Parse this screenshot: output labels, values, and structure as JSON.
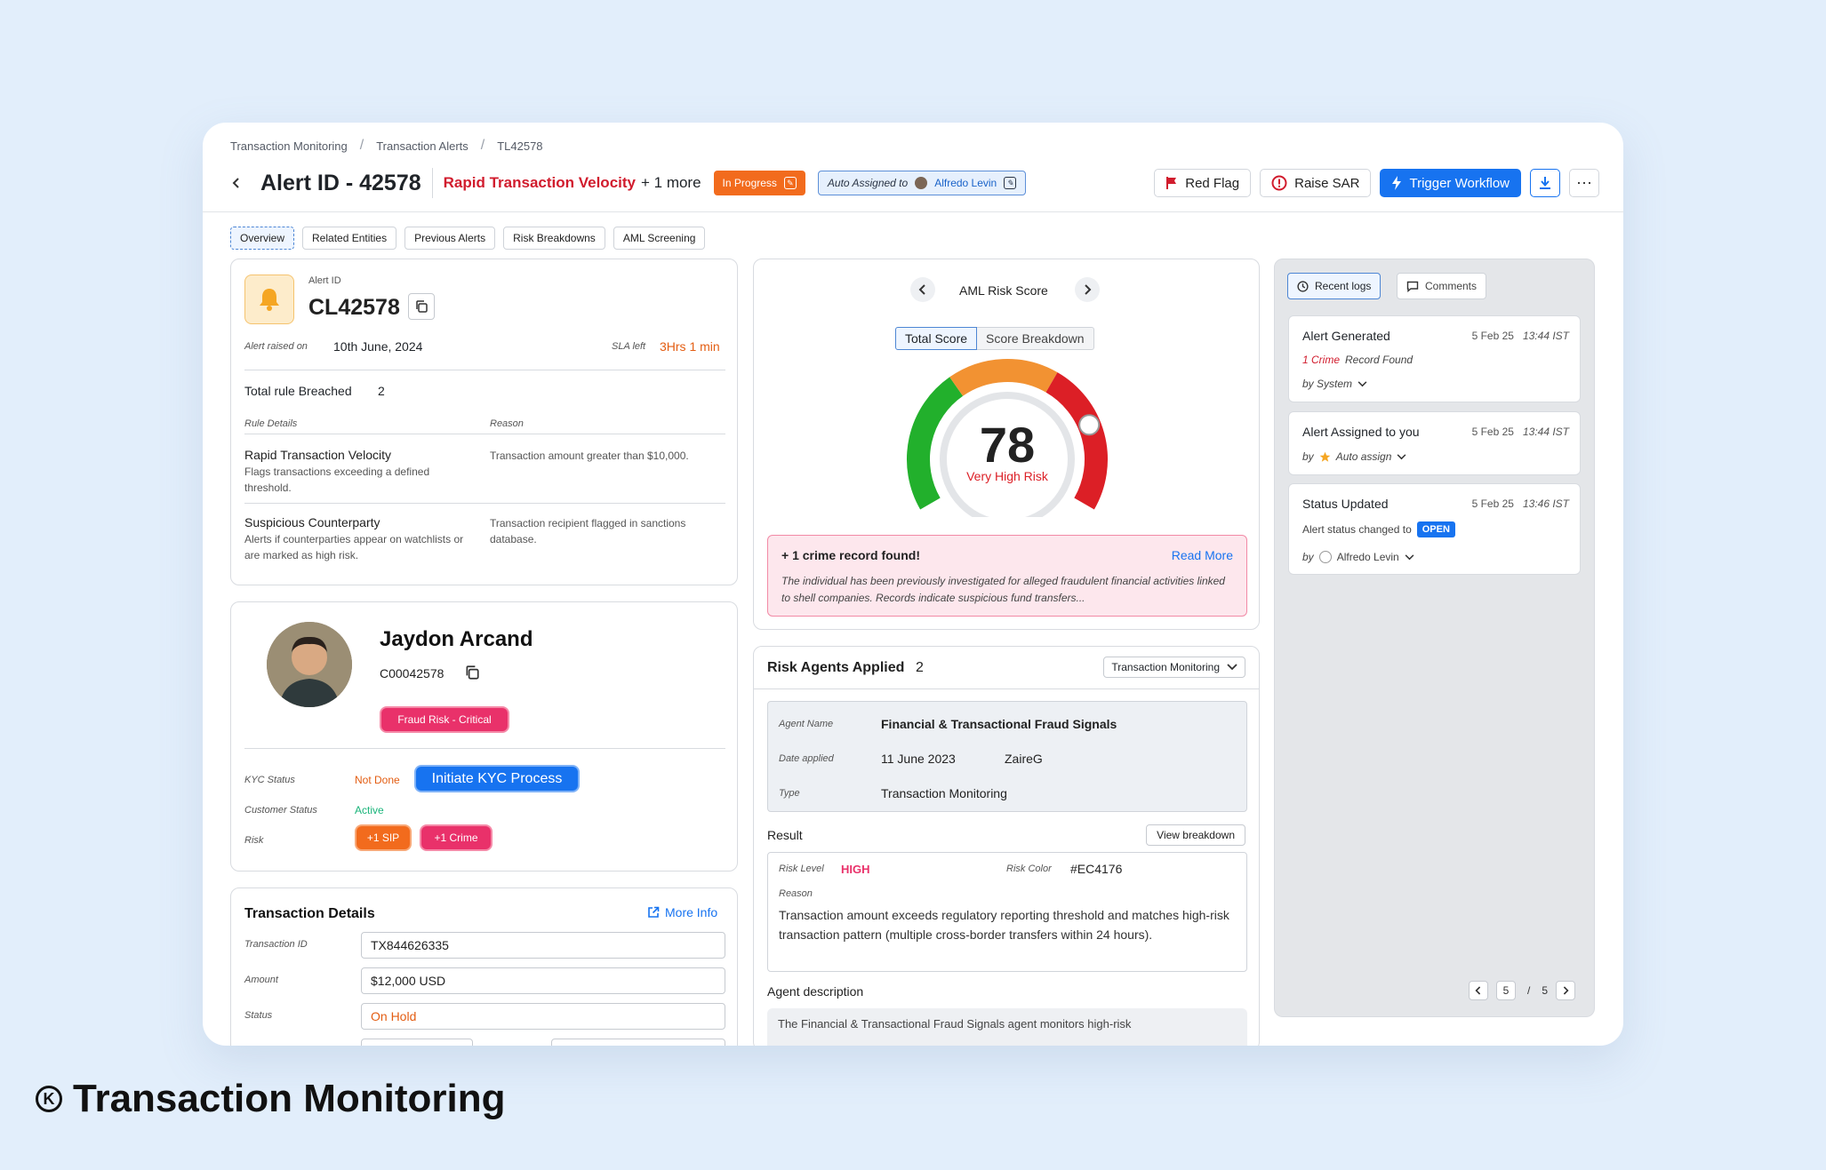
{
  "breadcrumb": [
    "Transaction Monitoring",
    "Transaction Alerts",
    "TL42578"
  ],
  "header": {
    "title": "Alert ID - 42578",
    "rule_name": "Rapid Transaction Velocity",
    "rule_more": "+ 1 more",
    "status": "In Progress",
    "assigned_label": "Auto Assigned to",
    "assigned_name": "Alfredo Levin",
    "red_flag": "Red Flag",
    "raise_sar": "Raise SAR",
    "trigger": "Trigger Workflow",
    "more_icon": "⋯"
  },
  "tabs": [
    "Overview",
    "Related Entities",
    "Previous Alerts",
    "Risk Breakdowns",
    "AML Screening"
  ],
  "alert": {
    "id_label": "Alert ID",
    "id": "CL42578",
    "raised_label": "Alert raised on",
    "raised_value": "10th June, 2024",
    "sla_label": "SLA left",
    "sla_value": "3Hrs 1 min",
    "total_label": "Total rule Breached",
    "total_value": "2",
    "col_rule": "Rule Details",
    "col_reason": "Reason",
    "rules": [
      {
        "name": "Rapid Transaction Velocity",
        "desc": "Flags transactions exceeding a defined threshold.",
        "reason": "Transaction amount greater than $10,000."
      },
      {
        "name": "Suspicious Counterparty",
        "desc": "Alerts if counterparties appear on watchlists or are marked as high risk.",
        "reason": "Transaction recipient flagged in sanctions database."
      }
    ]
  },
  "customer": {
    "name": "Jaydon Arcand",
    "id": "C00042578",
    "fraud_badge": "Fraud Risk - Critical",
    "kyc_label": "KYC Status",
    "kyc_value": "Not Done",
    "kyc_button": "Initiate KYC Process",
    "status_label": "Customer Status",
    "status_value": "Active",
    "risk_label": "Risk",
    "risk_badges": [
      "+1 SIP",
      "+1 Crime"
    ]
  },
  "transaction": {
    "title": "Transaction Details",
    "more_info": "More Info",
    "id_label": "Transaction ID",
    "id_value": "TX844626335",
    "amount_label": "Amount",
    "amount_value": "$12,000 USD",
    "status_label": "Status",
    "status_value": "On Hold"
  },
  "score": {
    "title": "AML Risk Score",
    "toggle_total": "Total Score",
    "toggle_breakdown": "Score Breakdown",
    "value": "78",
    "level": "Very High Risk",
    "gauge_fraction": 0.78,
    "colors": {
      "green": "#22b02c",
      "orange": "#f29232",
      "red": "#dc1f26"
    }
  },
  "crime": {
    "title": "+ 1 crime record found!",
    "read_more": "Read More",
    "body": "The individual has been previously investigated for alleged fraudulent financial activities linked to shell companies. Records indicate suspicious fund transfers..."
  },
  "agents": {
    "title": "Risk Agents Applied",
    "count": "2",
    "filter": "Transaction Monitoring",
    "agent_name_label": "Agent Name",
    "agent_name_value": "Financial & Transactional Fraud Signals",
    "date_label": "Date applied",
    "date_value": "11 June 2023",
    "applied_by": "ZaireG",
    "type_label": "Type",
    "type_value": "Transaction Monitoring",
    "result_label": "Result",
    "view_breakdown": "View breakdown",
    "risk_level_label": "Risk Level",
    "risk_level_value": "HIGH",
    "risk_color_label": "Risk Color",
    "risk_color_value": "#EC4176",
    "reason_label": "Reason",
    "reason_value": "Transaction amount exceeds regulatory reporting threshold and matches high-risk transaction pattern (multiple cross-border transfers within 24 hours).",
    "desc_label": "Agent description",
    "desc_value": "The Financial & Transactional Fraud Signals agent monitors high-risk"
  },
  "logs": {
    "tab_recent": "Recent logs",
    "tab_comments": "Comments",
    "items": [
      {
        "title": "Alert Generated",
        "date": "5 Feb 25",
        "time": "13:44 IST",
        "line_count": "1 Crime",
        "line_rest": "Record Found",
        "by": "by System"
      },
      {
        "title": "Alert Assigned to you",
        "date": "5 Feb 25",
        "time": "13:44 IST",
        "by_prefix": "by",
        "by_name": "Auto assign"
      },
      {
        "title": "Status Updated",
        "date": "5 Feb 25",
        "time": "13:46 IST",
        "line": "Alert status changed to",
        "badge": "OPEN",
        "by_prefix": "by",
        "by_name": "Alfredo Levin"
      }
    ],
    "page_current": "5",
    "page_sep": "/",
    "page_total": "5"
  },
  "footer": {
    "logo": "K",
    "title": "Transaction Monitoring"
  }
}
